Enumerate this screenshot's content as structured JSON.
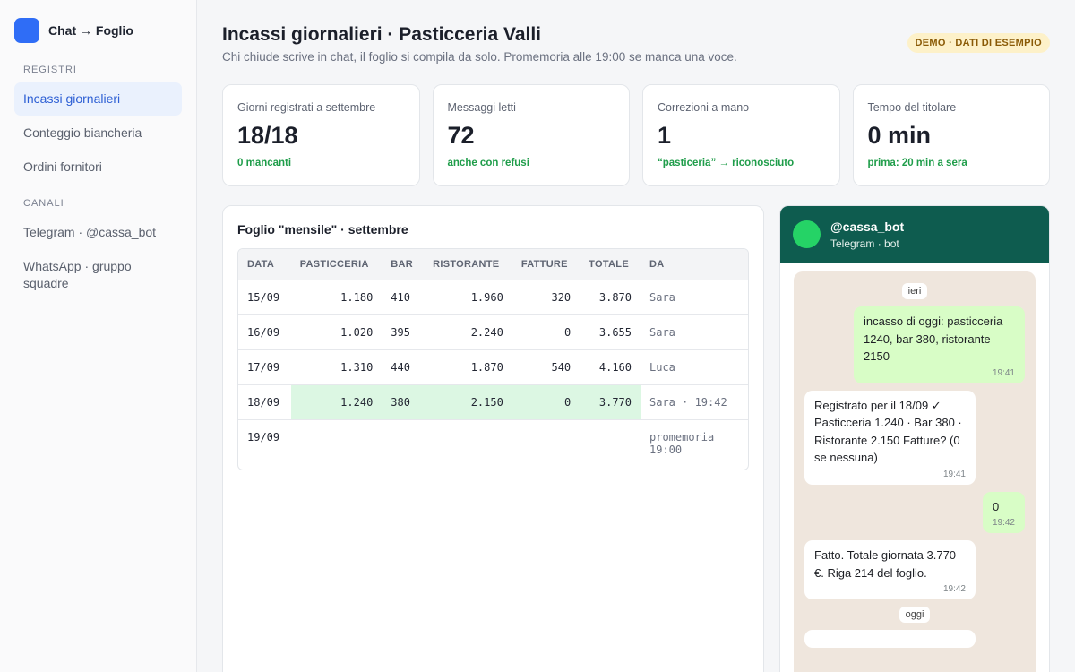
{
  "app": {
    "name": "Chat → Foglio"
  },
  "sidebar": {
    "registri_label": "REGISTRI",
    "registri": [
      {
        "label": "Incassi giornalieri",
        "active": true
      },
      {
        "label": "Conteggio biancheria",
        "active": false
      },
      {
        "label": "Ordini fornitori",
        "active": false
      }
    ],
    "canali_label": "CANALI",
    "canali": [
      {
        "label": "Telegram · @cassa_bot"
      },
      {
        "label": "WhatsApp · gruppo squadre"
      }
    ]
  },
  "header": {
    "title": "Incassi giornalieri · Pasticceria Valli",
    "subtitle": "Chi chiude scrive in chat, il foglio si compila da solo. Promemoria alle 19:00 se manca una voce.",
    "badge": "DEMO · DATI DI ESEMPIO"
  },
  "stats": [
    {
      "label": "Giorni registrati a settembre",
      "value": "18/18",
      "note": "0 mancanti"
    },
    {
      "label": "Messaggi letti",
      "value": "72",
      "note": "anche con refusi"
    },
    {
      "label": "Correzioni a mano",
      "value": "1",
      "note": "“pasticeria” → riconosciuto"
    },
    {
      "label": "Tempo del titolare",
      "value": "0 min",
      "note": "prima: 20 min a sera"
    }
  ],
  "sheet": {
    "title": "Foglio \"mensile\" · settembre",
    "columns": [
      "DATA",
      "PASTICCERIA",
      "BAR",
      "RISTORANTE",
      "FATTURE",
      "TOTALE",
      "DA"
    ],
    "rows": [
      {
        "data": "15/09",
        "pasticceria": "1.180",
        "bar": "410",
        "ristorante": "1.960",
        "fatture": "320",
        "totale": "3.870",
        "da": "Sara"
      },
      {
        "data": "16/09",
        "pasticceria": "1.020",
        "bar": "395",
        "ristorante": "2.240",
        "fatture": "0",
        "totale": "3.655",
        "da": "Sara"
      },
      {
        "data": "17/09",
        "pasticceria": "1.310",
        "bar": "440",
        "ristorante": "1.870",
        "fatture": "540",
        "totale": "4.160",
        "da": "Luca"
      },
      {
        "data": "18/09",
        "pasticceria": "1.240",
        "bar": "380",
        "ristorante": "2.150",
        "fatture": "0",
        "totale": "3.770",
        "da": "Sara · 19:42"
      },
      {
        "data": "19/09",
        "pasticceria": "",
        "bar": "",
        "ristorante": "",
        "fatture": "",
        "totale": "",
        "da": "promemoria 19:00"
      }
    ]
  },
  "chat": {
    "name": "@cassa_bot",
    "subtitle": "Telegram · bot",
    "day_yesterday": "ieri",
    "messages": [
      {
        "dir": "out",
        "text": "incasso di oggi: pasticceria 1240, bar 380, ristorante 2150",
        "time": "19:41"
      },
      {
        "dir": "in",
        "text": "Registrato per il 18/09 ✓ Pasticceria 1.240 · Bar 380 · Ristorante 2.150 Fatture? (0 se nessuna)",
        "time": "19:41"
      },
      {
        "dir": "out",
        "text": "0",
        "time": "19:42"
      },
      {
        "dir": "in",
        "text": "Fatto. Totale giornata 3.770 €. Riga 214 del foglio.",
        "time": "19:42"
      }
    ],
    "day_today": "oggi"
  },
  "colors": {
    "accent": "#2f6df6",
    "chat_header": "#0e5c4f",
    "positive": "#1f9d4a",
    "badge_bg": "#fdf1c9",
    "highlight_row": "#dcf7e3"
  }
}
